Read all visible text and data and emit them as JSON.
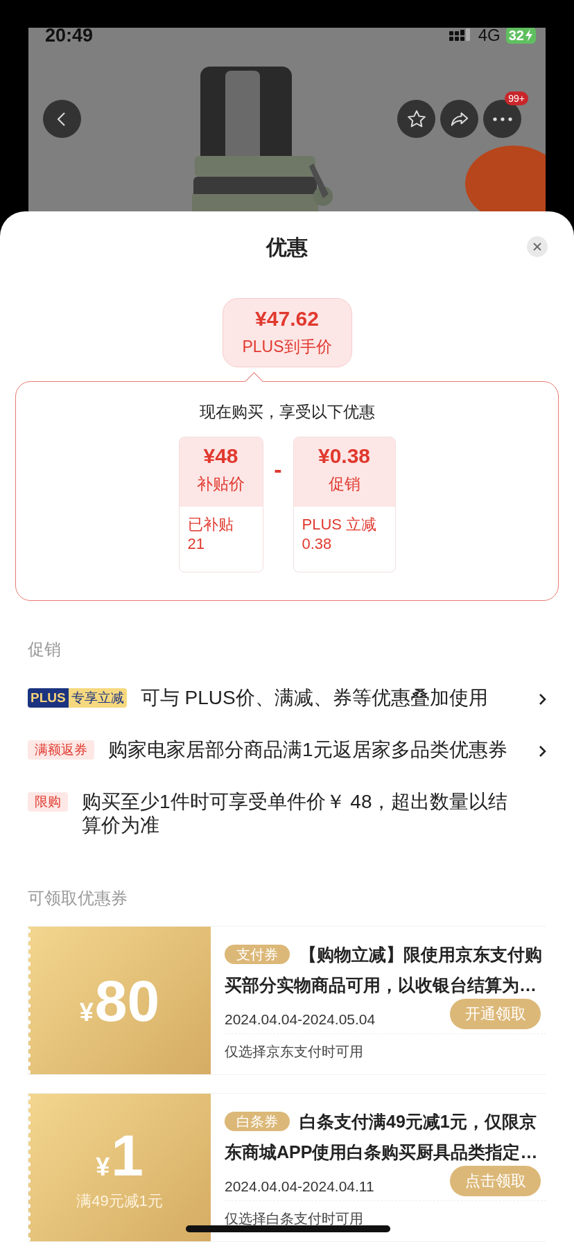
{
  "status_bar": {
    "time": "20:49",
    "network": "4G",
    "battery": "32"
  },
  "nav": {
    "badge": "99+"
  },
  "sheet": {
    "title": "优惠"
  },
  "final_price": {
    "amount": "¥47.62",
    "label": "PLUS到手价"
  },
  "breakdown": {
    "heading": "现在购买，享受以下优惠",
    "operator": "-",
    "items": [
      {
        "amount": "¥48",
        "label": "补贴价",
        "note_lines": [
          "已补贴",
          "21"
        ]
      },
      {
        "amount": "¥0.38",
        "label": "促销",
        "note_lines": [
          "PLUS 立减",
          "0.38"
        ]
      }
    ]
  },
  "promotions": {
    "title": "促销",
    "items": [
      {
        "kind": "plus",
        "tag": "PLUS",
        "tag_2": "专享立减",
        "text": "可与 PLUS价、满减、券等优惠叠加使用",
        "has_link": true
      },
      {
        "kind": "tag",
        "tag": "满额返券",
        "text": "购家电家居部分商品满1元返居家多品类优惠券",
        "has_link": true
      },
      {
        "kind": "tag",
        "tag": "限购",
        "text": "购买至少1件时可享受单件价￥ 48，超出数量以结算价为准",
        "has_link": false
      }
    ]
  },
  "coupons": {
    "title": "可领取优惠券",
    "items": [
      {
        "currency": "¥",
        "value": "80",
        "tag": "支付券",
        "text_lines": [
          "【购物立减】限使用京东支付购",
          "买部分实物商品可用，以收银台结算为…"
        ],
        "dates": "2024.04.04-2024.05.04",
        "button": "开通领取",
        "note": "仅选择京东支付时可用"
      },
      {
        "currency": "¥",
        "value": "1",
        "condition": "满49元减1元",
        "tag": "白条券",
        "text_lines": [
          "白条支付满49元减1元，仅限京",
          "东商城APP使用白条购买厨具品类指定…"
        ],
        "dates": "2024.04.04-2024.04.11",
        "button": "点击领取",
        "note": "仅选择白条支付时可用"
      }
    ]
  }
}
